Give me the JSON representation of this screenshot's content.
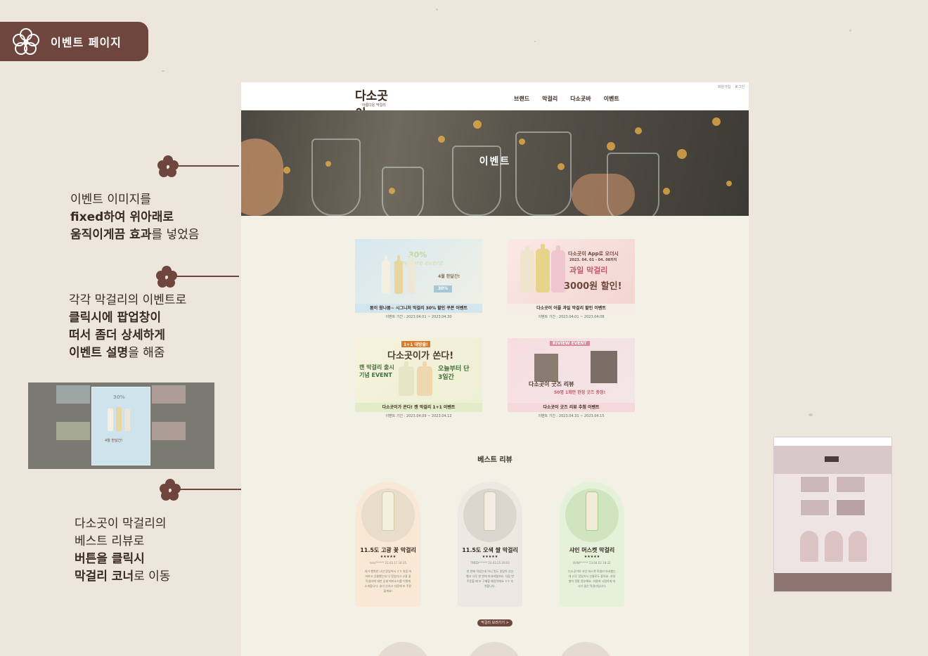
{
  "page_tag": {
    "label": "이벤트 페이지"
  },
  "notes": {
    "note1": {
      "line1": "이벤트 이미지를",
      "line2_bold": "fixed하여 위아래로",
      "line3_bold": "움직이게끔 효과",
      "line3_rest": "를 넣었음"
    },
    "note2": {
      "line1": "각각 막걸리의 이벤트로",
      "line2_bold": "클릭시에 팝업창이",
      "line3_bold": "떠서 좀더 상세하게",
      "line4_bold": "이벤트 설명",
      "line4_rest": "을 해줌"
    },
    "note3": {
      "line1": "다소곳이 막걸리의",
      "line2": "베스트 리뷰로",
      "line3_bold": "버튼을 클릭시",
      "line4_bold": "막걸리 코너",
      "line4_rest": "로 이동"
    }
  },
  "site": {
    "logo": {
      "main": "다소곳이",
      "sub": "아름다운 막걸리"
    },
    "util_links": [
      "회원가입",
      "로그인"
    ],
    "nav": [
      "브랜드",
      "막걸리",
      "다소곳바",
      "이벤트"
    ],
    "hero_title": "이벤트",
    "events": [
      {
        "title": "봄이 왔나봄~ 시그니처 막걸리 30% 할인 쿠폰 이벤트",
        "period": "이벤트 기간 : 2023.04.01 ~ 2023.04.30",
        "img_text_1": "30%",
        "img_text_2": "signature event",
        "img_text_3": "4월 한달간!",
        "img_text_4": "30%"
      },
      {
        "title": "다소곳이 어플 과일 막걸리 할인 이벤트",
        "period": "이벤트 기간 : 2023.04.01 ~ 2023.04.08",
        "img_text_1": "다소곳이 App로 오더시",
        "img_text_2": "2023. 04. 01 - 04. 08까지",
        "img_text_3": "과일 막걸리",
        "img_text_4": "3000원 할인!"
      },
      {
        "title": "다소곳이가 쏜다! 캔 막걸리 1+1 이벤트",
        "period": "이벤트 기간 : 2023.04.09 ~ 2023.04.12",
        "img_text_1": "1+1 대방출!",
        "img_text_2": "다소곳이가 쏜다!",
        "img_text_3": "캔 막걸리 출시 기념 EVENT",
        "img_text_4": "오늘부터 단 3일간"
      },
      {
        "title": "다소곳이 굿즈 리뷰 추첨 이벤트",
        "period": "이벤트 기간 : 2023.04.31 ~ 2023.04.15",
        "img_text_1": "RIVIEW EVENT",
        "img_text_2": "다소곳이 굿즈 리뷰",
        "img_text_3": "50명 1회만 한정 굿즈 증정!"
      }
    ],
    "best_review_title": "베스트 리뷰",
    "reviews": [
      {
        "name": "11.5도 고광 꽃 막걸리",
        "stars": "★★★★★",
        "meta": "ssss****** 23.03.17 14:25",
        "body": "처가 행복한 나만 맛있어서 ㅎㅎ 처음 마셔보고 선물했는데 다 맛있다고 고광 꽃 막걸리에 대한 상세 에피소드를 이렇게 소개합니다. 술이 순하고 다음에 또 주문할게요!"
      },
      {
        "name": "11.5도 오색 쌀 막걸리",
        "stars": "★★★★★",
        "meta": "TMDD****** 23.03.25 20:02",
        "body": "한 번에 먹었는데 아니 맛도 맛있어 신선했고 너무 한 번에 마셔버렸어요. 다음 번 주문할 때 또 구매할 예정이에요 ㅎㅎ 추천합니다."
      },
      {
        "name": "샤인 머스켓 막걸리",
        "stars": "★★★★★",
        "meta": "KANI****** 23.04.02 18:32",
        "body": "다소곳이의 샤인 머스켓 막걸리 마셔봤는데 너무 맛있어서 선물로도 좋아요. 과일 향이 정말 풍부해요. 여름에 시원하게 마시기 좋은 막걸리입니다."
      }
    ],
    "more_button": "막걸리 보러가기 >"
  },
  "popup_preview": {
    "label": "30%",
    "sub": "4월 한달간!"
  },
  "colors": {
    "brown": "#6e463d",
    "paper": "#ece6dc",
    "site_bg": "#f3f1e6"
  }
}
